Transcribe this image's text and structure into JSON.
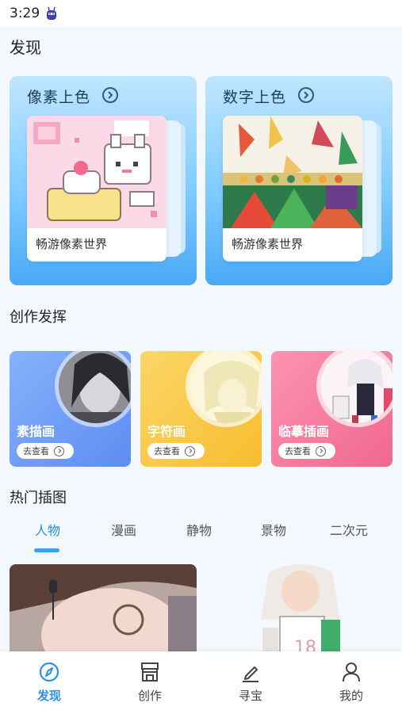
{
  "status_bar": {
    "time": "3:29",
    "icon": "android-bot-icon"
  },
  "page_title": "发现",
  "coloring": [
    {
      "title": "像素上色",
      "subtitle": "畅游像素世界",
      "icon": "arrow-circle-right-icon"
    },
    {
      "title": "数字上色",
      "subtitle": "畅游像素世界",
      "icon": "arrow-circle-right-icon"
    }
  ],
  "create_section": {
    "title": "创作发挥",
    "cards": [
      {
        "title": "素描画",
        "button": "去查看",
        "color": "#6f9cf6"
      },
      {
        "title": "字符画",
        "button": "去查看",
        "color": "#f9c43d"
      },
      {
        "title": "临摹插画",
        "button": "去查看",
        "color": "#f57ea0"
      }
    ]
  },
  "hot_section": {
    "title": "热门插图",
    "tabs": [
      "人物",
      "漫画",
      "静物",
      "景物",
      "二次元"
    ],
    "active_tab": "人物"
  },
  "bottom_nav": [
    {
      "label": "发现",
      "icon": "compass-icon",
      "active": true
    },
    {
      "label": "创作",
      "icon": "store-icon",
      "active": false
    },
    {
      "label": "寻宝",
      "icon": "pen-icon",
      "active": false
    },
    {
      "label": "我的",
      "icon": "user-icon",
      "active": false
    }
  ],
  "colors": {
    "accent": "#2d8fe6",
    "card_blue": "#7fcbff",
    "background": "#f2f8fe"
  }
}
